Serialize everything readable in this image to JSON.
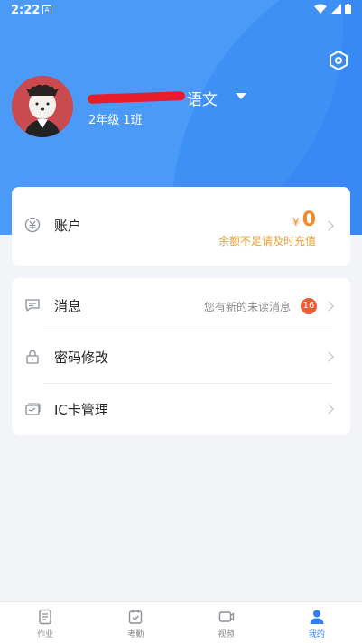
{
  "status_bar": {
    "time": "2:22",
    "notification_letter": "A"
  },
  "profile": {
    "name_suffix": "语文",
    "class": "2年级 1班"
  },
  "account": {
    "label": "账户",
    "currency": "¥",
    "balance": "0",
    "warning": "余额不足请及时充值"
  },
  "menu": {
    "messages": {
      "label": "消息",
      "hint": "您有新的未读消息",
      "badge": "16"
    },
    "password": {
      "label": "密码修改"
    },
    "ic_card": {
      "label": "IC卡管理"
    }
  },
  "tabs": [
    {
      "label": "作业",
      "icon": "homework-icon"
    },
    {
      "label": "考勤",
      "icon": "attendance-icon"
    },
    {
      "label": "视频",
      "icon": "video-icon"
    },
    {
      "label": "我的",
      "icon": "profile-icon",
      "active": true
    }
  ],
  "colors": {
    "primary": "#3d8bf4",
    "accent": "#f08b2e",
    "badge": "#ee5a32"
  }
}
